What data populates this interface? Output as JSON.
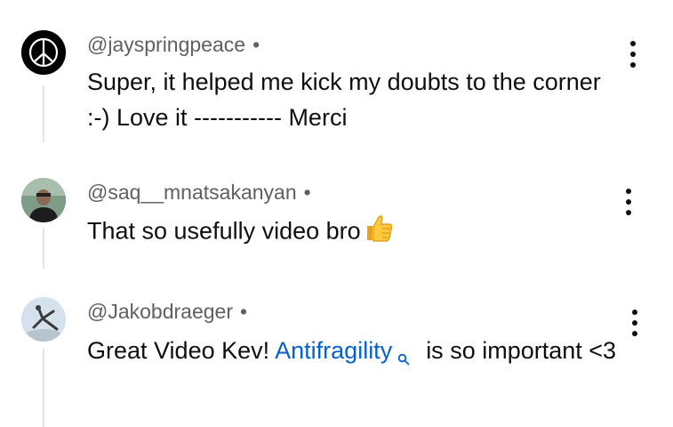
{
  "comments": [
    {
      "author": "@jayspringpeace",
      "separator": "•",
      "text": "Super, it helped me kick my doubts to the corner :-) Love it ----------- Merci",
      "avatar": "peace-sign-icon"
    },
    {
      "author": "@saq__mnatsakanyan",
      "separator": "•",
      "text": "That so usefully video bro",
      "emoji": "thumbs-up-icon",
      "avatar": "person-photo"
    },
    {
      "author": "@Jakobdraeger",
      "separator": "•",
      "text_before": "Great Video Kev! ",
      "link": "Antifragility",
      "text_after": "is so important <3",
      "avatar": "jumping-figure-photo"
    }
  ],
  "colors": {
    "link": "#065fd4",
    "muted": "#606060",
    "thread_line": "#e5e5e5"
  }
}
